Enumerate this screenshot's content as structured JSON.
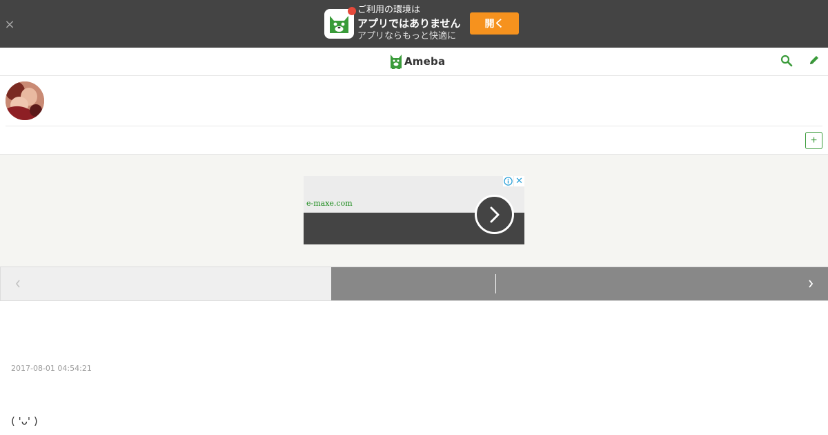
{
  "app_banner": {
    "line1": "ご利用の環境は",
    "line2": "アプリではありません",
    "line3": "アプリならもっと快適に",
    "open_label": "開く",
    "close_glyph": "×"
  },
  "header": {
    "logo_text": "Ameba"
  },
  "tabbar": {
    "add_label": "+"
  },
  "ad": {
    "domain": "e-maxe.com",
    "close_glyph": "✕"
  },
  "entry": {
    "date": "2017-08-01 04:54:21",
    "body": "( 'ᴗ' )"
  },
  "colors": {
    "brand_green": "#3a9b3a",
    "banner_bg": "#444444",
    "open_button": "#f6921e",
    "notif_dot": "#e5493a"
  }
}
